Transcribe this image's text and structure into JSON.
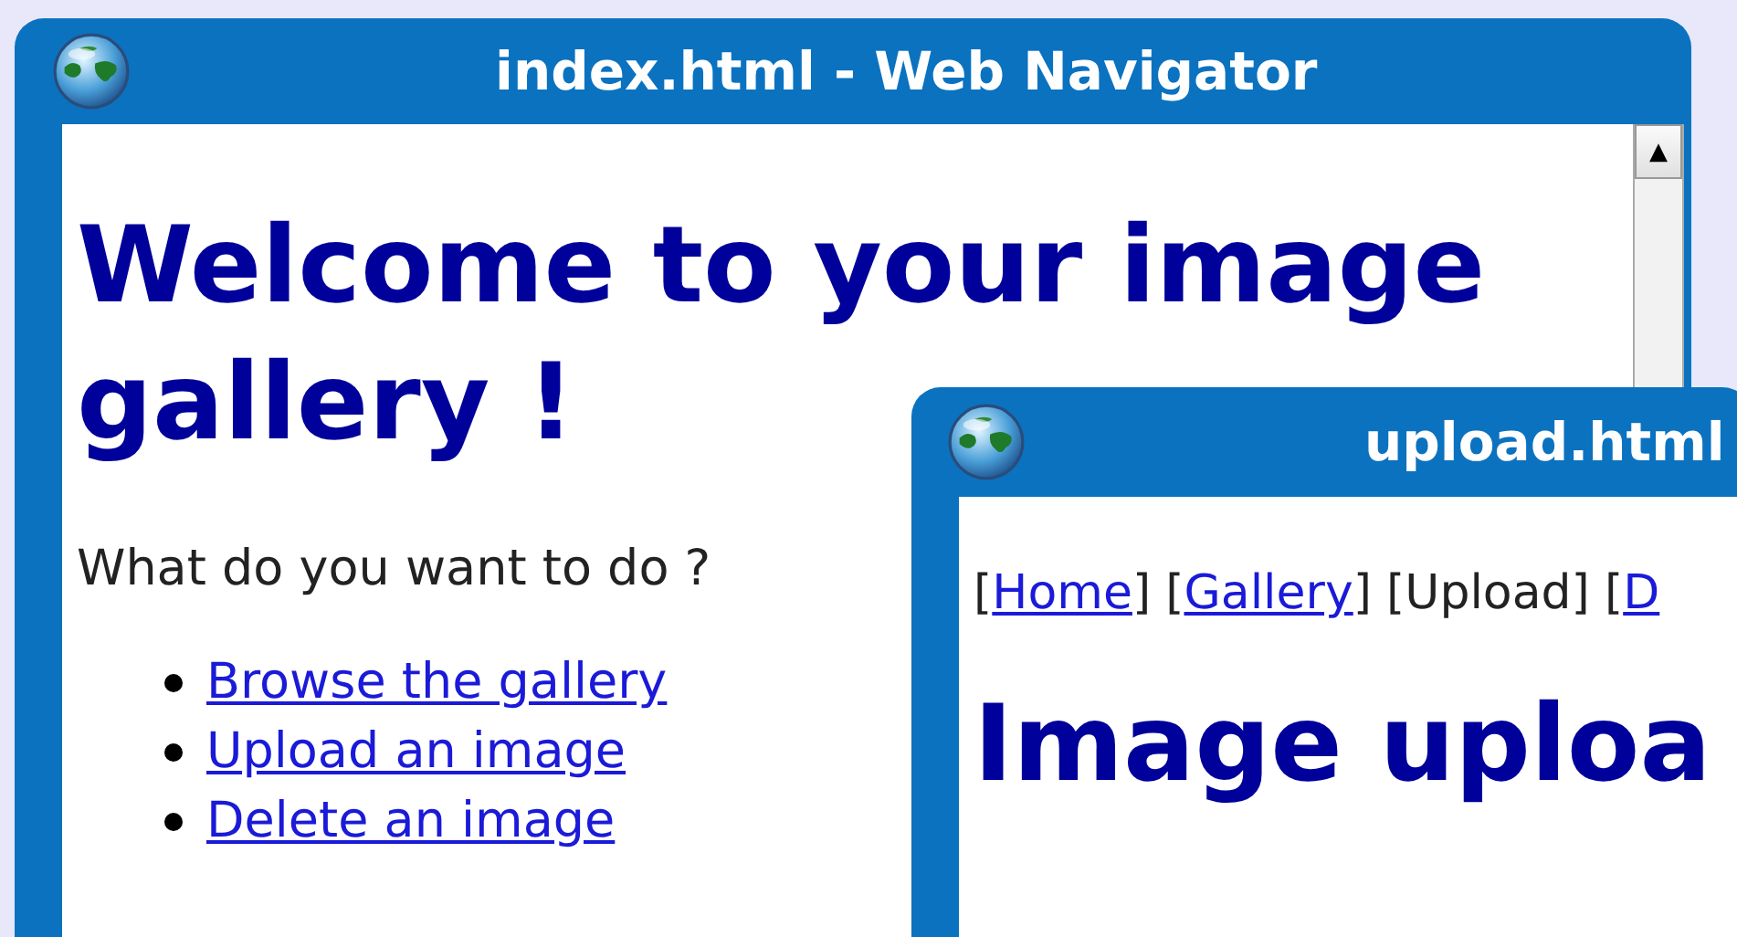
{
  "windows": [
    {
      "title": "index.html - Web Navigator",
      "scrollbar": {
        "arrow": "▲"
      },
      "heading_lines": [
        "Welcome to your image",
        "gallery !"
      ],
      "prompt": "What do you want to do ?",
      "links": [
        "Browse the gallery",
        "Upload an image",
        "Delete an image"
      ]
    },
    {
      "title": "upload.html",
      "nav": [
        {
          "open": "[",
          "label": "Home",
          "close": "]",
          "kind": "link"
        },
        {
          "open": "[",
          "label": "Gallery",
          "close": "]",
          "kind": "link"
        },
        {
          "open": "[",
          "label": "Upload",
          "close": "]",
          "kind": "current"
        },
        {
          "open": "[",
          "label": "D",
          "kind": "link"
        }
      ],
      "heading": "Image uploa"
    }
  ]
}
